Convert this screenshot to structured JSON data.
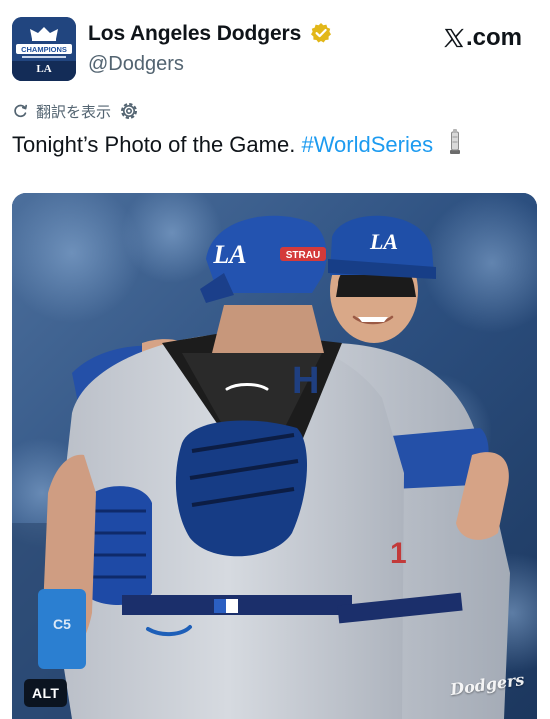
{
  "post": {
    "display_name": "Los Angeles Dodgers",
    "handle": "@Dodgers",
    "verified_badge_color": "#e2b719",
    "avatar_icon": "world-series-champions-logo"
  },
  "platform": {
    "logo_text": ".com",
    "logo_icon": "x-logo-icon"
  },
  "translate": {
    "label": "翻訳を表示",
    "icon": "translate-icon",
    "settings_icon": "gear-icon"
  },
  "tweet": {
    "text": "Tonight’s Photo of the Game.",
    "hashtag": "#WorldSeries",
    "emoji_icon": "trophy-icon",
    "hashtag_color": "#1d9bf0"
  },
  "media": {
    "alt_label": "ALT",
    "watermark": "Dodgers",
    "helmet_logo": "LA",
    "cap_logo": "LA",
    "sponsor_patch": "STRAU",
    "wristband_text": "C5",
    "jersey_letter": "H",
    "brand_color": "#1e5fb8"
  }
}
